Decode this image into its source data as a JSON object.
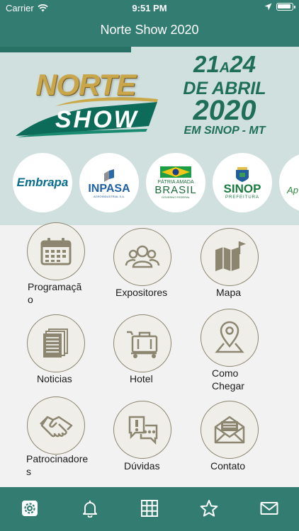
{
  "status_bar": {
    "carrier": "Carrier",
    "time": "9:51 PM"
  },
  "nav": {
    "title": "Norte Show 2020"
  },
  "banner": {
    "logo_top": "NORTE",
    "logo_bottom": "SHOW",
    "date_line1_a": "21",
    "date_line1_sep": "A",
    "date_line1_b": "24",
    "date_line2": "DE ABRIL",
    "date_line3": "2020",
    "date_line4": "EM SINOP - MT"
  },
  "partners": [
    {
      "name": "Embrapa"
    },
    {
      "name": "INPASA",
      "sub": "AGROINDUSTRIAL S.A."
    },
    {
      "name_top": "PÁTRIA AMADA",
      "name": "BRASIL",
      "sub": "GOVERNO FEDERAL"
    },
    {
      "name": "SINOP",
      "sub": "PREFEITURA"
    },
    {
      "name": "Ap"
    }
  ],
  "menu": [
    {
      "label": "Programação",
      "icon": "calendar-icon"
    },
    {
      "label": "Expositores",
      "icon": "people-icon"
    },
    {
      "label": "Mapa",
      "icon": "map-icon"
    },
    {
      "label": "Noticias",
      "icon": "newspaper-icon"
    },
    {
      "label": "Hotel",
      "icon": "luggage-icon"
    },
    {
      "label": "Como Chegar",
      "icon": "location-pin-icon"
    },
    {
      "label": "Patrocinadores",
      "icon": "handshake-icon"
    },
    {
      "label": "Dúvidas",
      "icon": "chat-question-icon"
    },
    {
      "label": "Contato",
      "icon": "envelope-icon"
    }
  ],
  "tabbar": [
    "gear-icon",
    "bell-icon",
    "grid-icon",
    "star-icon",
    "mail-icon"
  ],
  "colors": {
    "primary": "#327c72",
    "banner_bg": "#d0e0df",
    "icon": "#8c8570",
    "date_text": "#1f6e5a",
    "logo_gold": "#caa64a"
  }
}
